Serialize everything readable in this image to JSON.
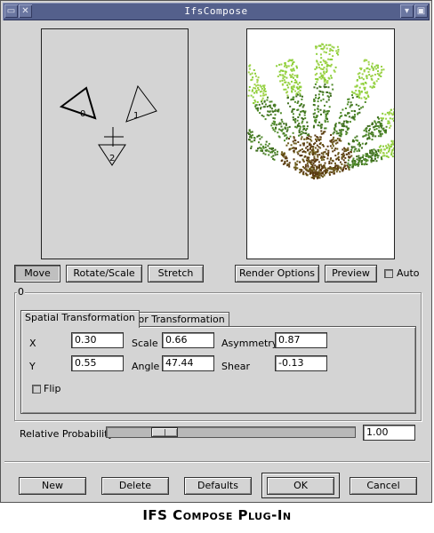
{
  "window": {
    "title": "IfsCompose",
    "left_icons": [
      "window-menu-icon",
      "iconify-icon"
    ],
    "right_icons": [
      "collapse-icon",
      "close-icon"
    ]
  },
  "design": {
    "transforms": [
      {
        "label": "0"
      },
      {
        "label": "1"
      },
      {
        "label": "2"
      }
    ]
  },
  "mode_buttons": {
    "move": "Move",
    "rotate_scale": "Rotate/Scale",
    "stretch": "Stretch",
    "active": "move"
  },
  "preview_buttons": {
    "render_options": "Render Options",
    "preview": "Preview",
    "auto_label": "Auto",
    "auto_checked": false
  },
  "transform_frame": {
    "label": "0"
  },
  "tabs": [
    {
      "label": "Spatial Transformation",
      "active": true
    },
    {
      "label": "Color Transformation",
      "active": false
    }
  ],
  "spatial": {
    "x_label": "X",
    "x_value": "0.30",
    "y_label": "Y",
    "y_value": "0.55",
    "scale_label": "Scale",
    "scale_value": "0.66",
    "angle_label": "Angle",
    "angle_value": "47.44",
    "asymmetry_label": "Asymmetry",
    "asymmetry_value": "0.87",
    "shear_label": "Shear",
    "shear_value": "-0.13",
    "flip_label": "Flip",
    "flip_checked": false
  },
  "probability": {
    "label": "Relative Probability:",
    "value": "1.00"
  },
  "action_buttons": {
    "new": "New",
    "delete": "Delete",
    "defaults": "Defaults",
    "ok": "OK",
    "cancel": "Cancel"
  },
  "caption": "IFS Compose Plug-In",
  "colors": {
    "titlebar": "#54608c",
    "window_bg": "#d4d4d4",
    "fern_dark": "#5a3a10",
    "fern_green": "#4f8a2a",
    "fern_light": "#8ccf3a"
  }
}
